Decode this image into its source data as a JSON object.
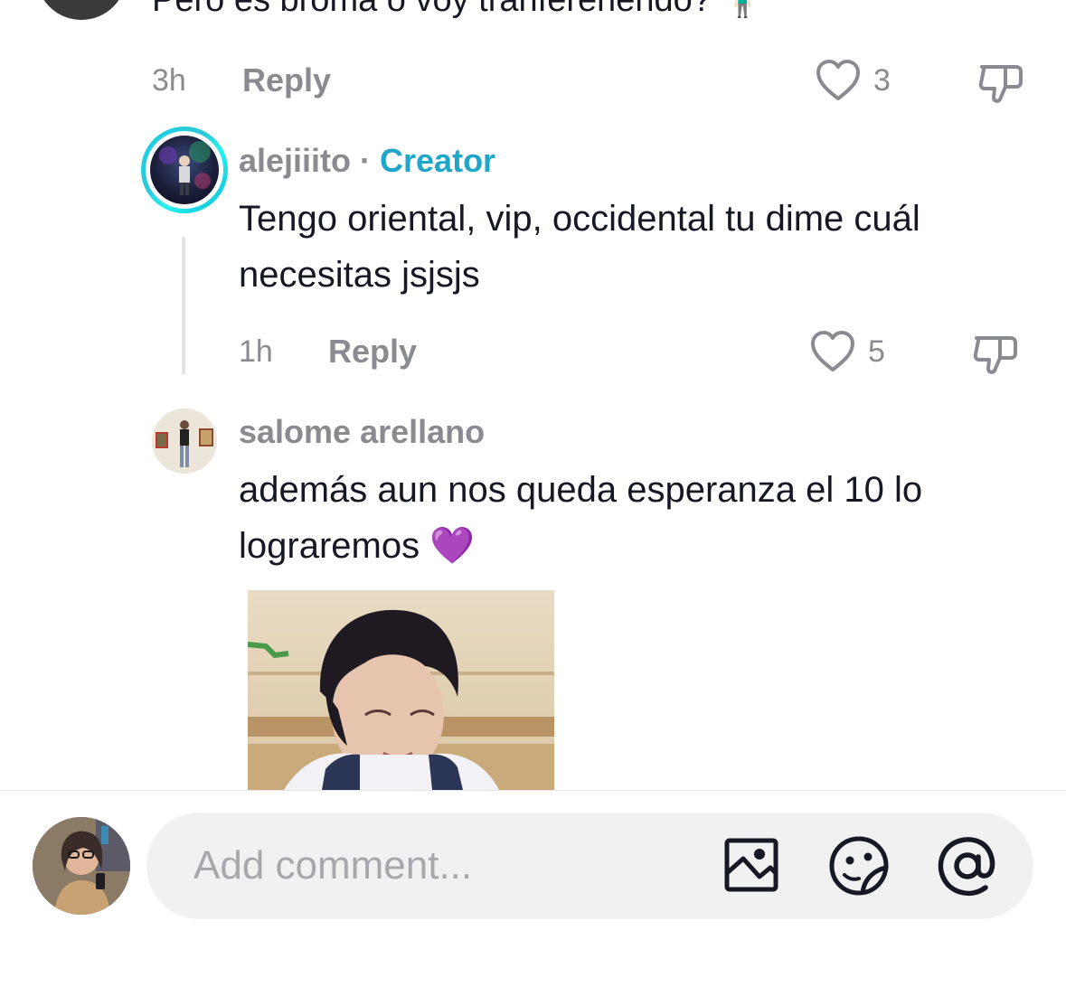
{
  "top_comment": {
    "text": "Pero es broma o voy tranfereriendo? 🧍🏻‍♂️",
    "time": "3h",
    "reply_label": "Reply",
    "like_count": "3"
  },
  "creator_reply": {
    "username": "alejiiito",
    "separator": " · ",
    "badge": "Creator",
    "text": "Tengo oriental, vip, occidental tu dime cuál necesitas jsjsjs",
    "time": "1h",
    "reply_label": "Reply",
    "like_count": "5"
  },
  "salome_comment": {
    "username": "salome arellano",
    "text": "además aun nos queda esperanza el 10 lo lograremos 💜"
  },
  "composer": {
    "placeholder": "Add comment...",
    "icons": [
      "image-icon",
      "sticker-emoji-icon",
      "mention-icon"
    ]
  },
  "colors": {
    "creator_accent": "#20a6c9",
    "muted_text": "#8a8b91",
    "primary_text": "#161823",
    "input_bg": "#f1f1f2"
  }
}
